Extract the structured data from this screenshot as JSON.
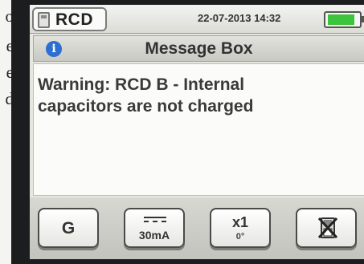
{
  "side_letters": [
    "o",
    "e",
    "e",
    "d"
  ],
  "status": {
    "mode": "RCD",
    "datetime": "22-07-2013 14:32",
    "meter_icon": "meter-icon",
    "battery_level": 0.9,
    "battery_color": "#3cc43c"
  },
  "dialog": {
    "title": "Message Box",
    "title_icon": "info-icon",
    "title_icon_glyph": "i",
    "message_line1": "Warning: RCD B - Internal",
    "message_line2": "capacitors are not charged"
  },
  "softkeys": {
    "key1_label": "G",
    "key2_symbol": "dc-current-icon",
    "key2_label": "30mA",
    "key3_label": "x1",
    "key3_sub": "0°",
    "key4_icon": "no-save-icon"
  }
}
